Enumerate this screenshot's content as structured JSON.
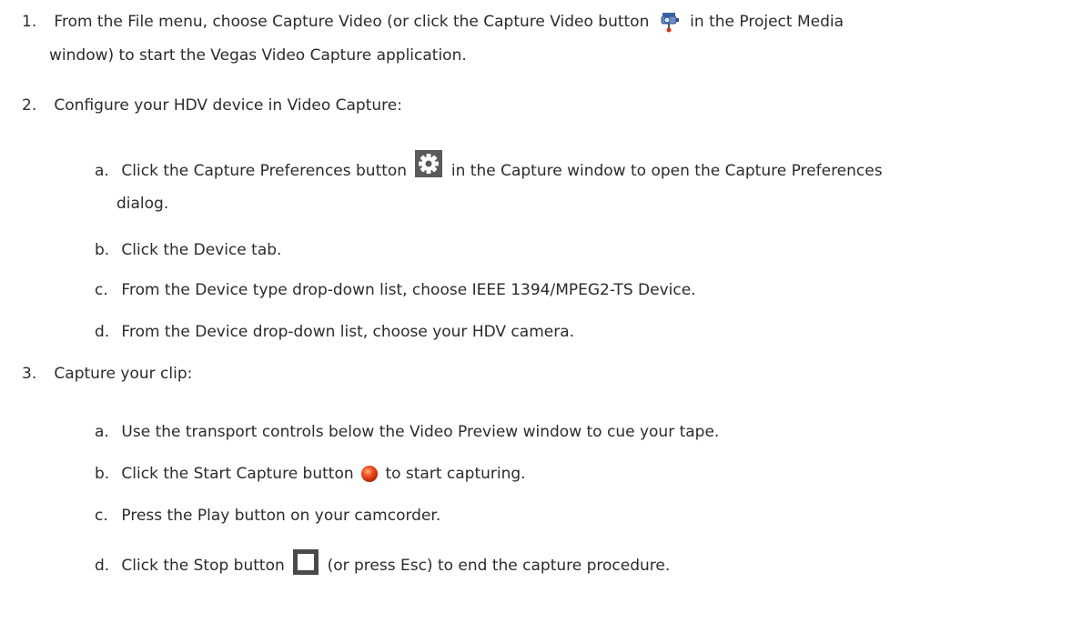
{
  "steps": [
    {
      "number": "1.",
      "text_before_icon": "From the File menu, choose Capture Video (or click the Capture Video button",
      "icon": "capture-video-camera-icon",
      "text_after_icon": "in the Project Media",
      "text_line2": "window) to start the Vegas Video Capture application."
    },
    {
      "number": "2.",
      "text": "Configure your HDV device in Video Capture:",
      "substeps": [
        {
          "letter": "a.",
          "text_before_icon": "Click the Capture Preferences button",
          "icon": "gear-icon",
          "text_after_icon": "in the Capture window to open the Capture Preferences",
          "text_line2": "dialog."
        },
        {
          "letter": "b.",
          "text": "Click the Device tab."
        },
        {
          "letter": "c.",
          "text": "From the Device type drop-down list, choose IEEE 1394/MPEG2-TS Device."
        },
        {
          "letter": "d.",
          "text": "From the Device drop-down list, choose your HDV camera."
        }
      ]
    },
    {
      "number": "3.",
      "text": "Capture your clip:",
      "substeps": [
        {
          "letter": "a.",
          "text": "Use the transport controls below the Video Preview window to cue your tape."
        },
        {
          "letter": "b.",
          "text_before_icon": "Click the Start Capture button",
          "icon": "record-icon",
          "text_after_icon": "to start capturing."
        },
        {
          "letter": "c.",
          "text": "Press the Play button on your camcorder."
        },
        {
          "letter": "d.",
          "text_before_icon": "Click the Stop button",
          "icon": "stop-icon",
          "text_after_icon": "(or press Esc) to end the capture procedure."
        }
      ]
    }
  ],
  "colors": {
    "text": "#2b2b2b",
    "record": "#e8401c",
    "gear_bg": "#5a5a5a",
    "stop_bg": "#4a4a4a"
  }
}
